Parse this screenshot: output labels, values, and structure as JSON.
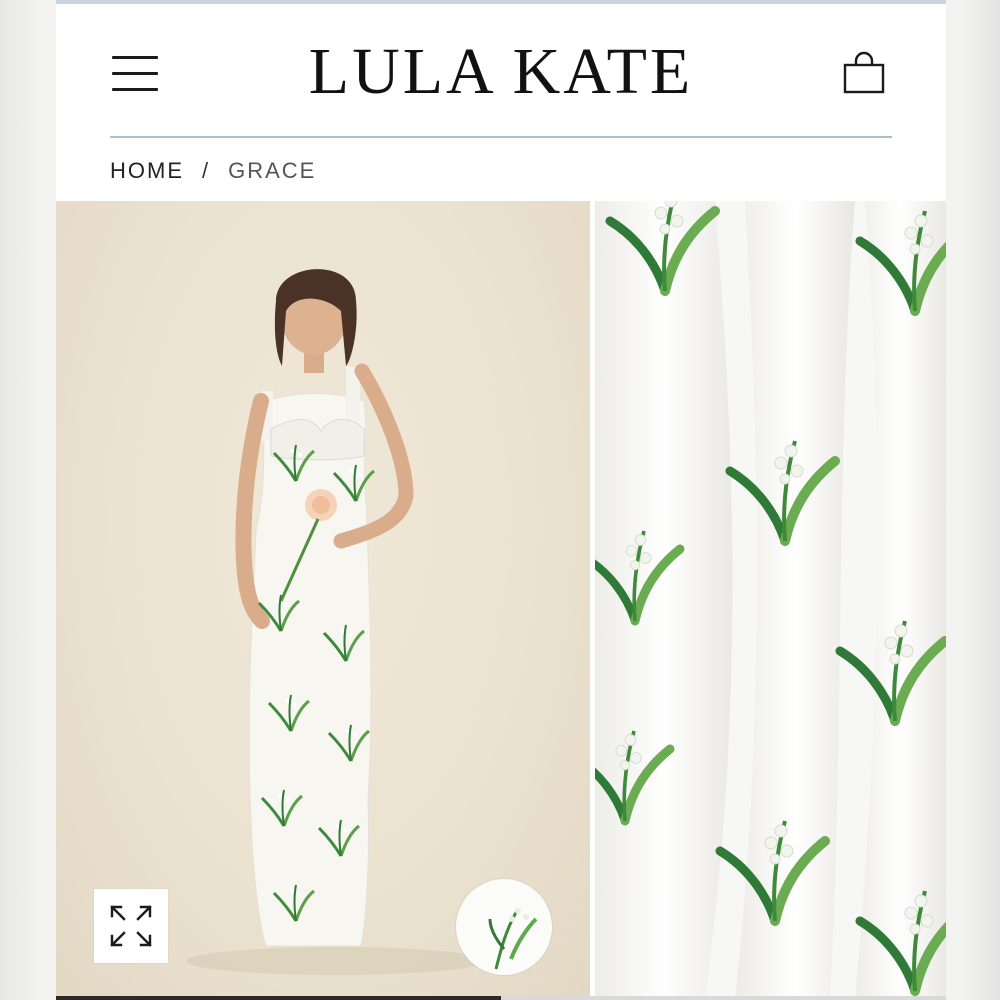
{
  "header": {
    "brand": "LULA KATE",
    "menu_icon": "hamburger-menu-icon",
    "cart_icon": "shopping-bag-icon"
  },
  "breadcrumb": {
    "home": "HOME",
    "separator": "/",
    "current": "GRACE"
  },
  "gallery": {
    "expand_icon": "expand-arrows-icon",
    "scroll_progress": 0.5
  },
  "colors": {
    "accent_divider": "#a9bfcf",
    "top_bar": "#c9d6e2",
    "background": "#ffffff",
    "text": "#1b1b1b"
  }
}
